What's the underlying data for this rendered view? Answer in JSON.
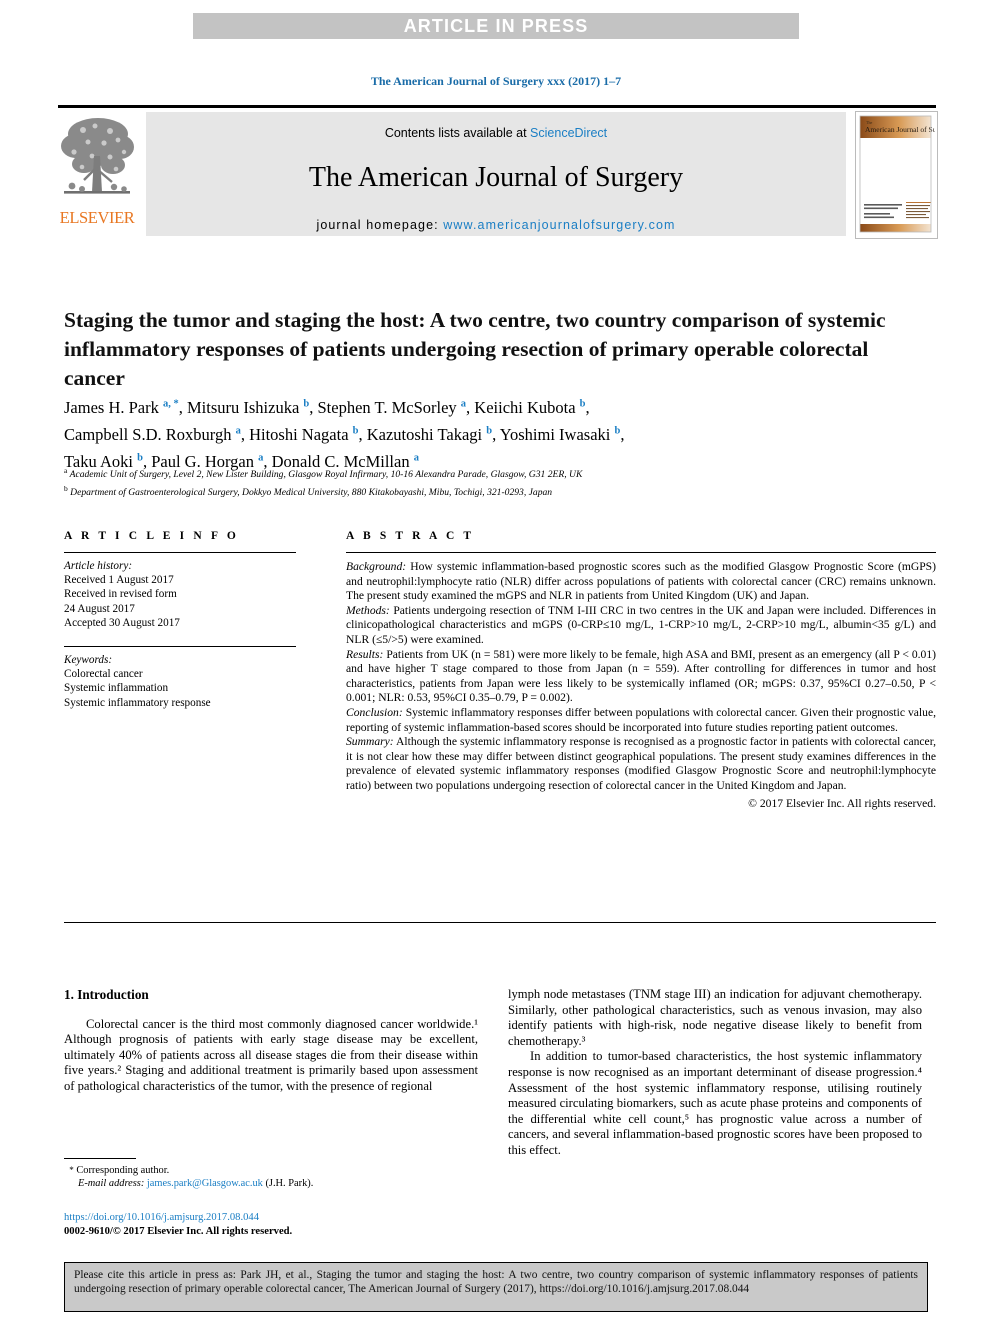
{
  "banner": {
    "text": "ARTICLE IN PRESS"
  },
  "running_head": {
    "text": "The American Journal of Surgery xxx (2017) 1–7"
  },
  "masthead": {
    "contents_prefix": "Contents lists available at ",
    "sciencedirect": "ScienceDirect",
    "journal_name": "The American Journal of Surgery",
    "homepage_prefix": "journal homepage: ",
    "homepage_url": "www.americanjournalofsurgery.com",
    "publisher_logo_text": "ELSEVIER",
    "cover_title": "The American Journal of Surgery",
    "accent_orange": "#e87722",
    "link_blue": "#1a7ec4",
    "band_gray": "#e6e6e6"
  },
  "article": {
    "title": "Staging the tumor and staging the host: A two centre, two country comparison of systemic inflammatory responses of patients undergoing resection of primary operable colorectal cancer",
    "authors": [
      {
        "name": "James H. Park",
        "marks": "a, *"
      },
      {
        "name": "Mitsuru Ishizuka",
        "marks": "b"
      },
      {
        "name": "Stephen T. McSorley",
        "marks": "a"
      },
      {
        "name": "Keiichi Kubota",
        "marks": "b"
      },
      {
        "name": "Campbell S.D. Roxburgh",
        "marks": "a"
      },
      {
        "name": "Hitoshi Nagata",
        "marks": "b"
      },
      {
        "name": "Kazutoshi Takagi",
        "marks": "b"
      },
      {
        "name": "Yoshimi Iwasaki",
        "marks": "b"
      },
      {
        "name": "Taku Aoki",
        "marks": "b"
      },
      {
        "name": "Paul G. Horgan",
        "marks": "a"
      },
      {
        "name": "Donald C. McMillan",
        "marks": "a"
      }
    ],
    "affiliations": [
      {
        "mark": "a",
        "text": "Academic Unit of Surgery, Level 2, New Lister Building, Glasgow Royal Infirmary, 10-16 Alexandra Parade, Glasgow, G31 2ER, UK"
      },
      {
        "mark": "b",
        "text": "Department of Gastroenterological Surgery, Dokkyo Medical University, 880 Kitakobayashi, Mibu, Tochigi, 321-0293, Japan"
      }
    ]
  },
  "article_info": {
    "heading": "A R T I C L E  I N F O",
    "history_label": "Article history:",
    "history": [
      "Received 1 August 2017",
      "Received in revised form",
      "24 August 2017",
      "Accepted 30 August 2017"
    ],
    "keywords_label": "Keywords:",
    "keywords": [
      "Colorectal cancer",
      "Systemic inflammation",
      "Systemic inflammatory response"
    ]
  },
  "abstract": {
    "heading": "A B S T R A C T",
    "sections": [
      {
        "label": "Background:",
        "text": " How systemic inflammation-based prognostic scores such as the modified Glasgow Prognostic Score (mGPS) and neutrophil:lymphocyte ratio (NLR) differ across populations of patients with colorectal cancer (CRC) remains unknown. The present study examined the mGPS and NLR in patients from United Kingdom (UK) and Japan."
      },
      {
        "label": "Methods:",
        "text": " Patients undergoing resection of TNM I-III CRC in two centres in the UK and Japan were included. Differences in clinicopathological characteristics and mGPS (0-CRP≤10 mg/L, 1-CRP>10 mg/L, 2-CRP>10 mg/L, albumin<35 g/L) and NLR (≤5/>5) were examined."
      },
      {
        "label": "Results:",
        "text": " Patients from UK (n = 581) were more likely to be female, high ASA and BMI, present as an emergency (all P < 0.01) and have higher T stage compared to those from Japan (n = 559). After controlling for differences in tumor and host characteristics, patients from Japan were less likely to be systemically inflamed (OR; mGPS: 0.37, 95%CI 0.27–0.50, P < 0.001; NLR: 0.53, 95%CI 0.35–0.79, P = 0.002)."
      },
      {
        "label": "Conclusion:",
        "text": " Systemic inflammatory responses differ between populations with colorectal cancer. Given their prognostic value, reporting of systemic inflammation-based scores should be incorporated into future studies reporting patient outcomes."
      },
      {
        "label": "Summary:",
        "text": " Although the systemic inflammatory response is recognised as a prognostic factor in patients with colorectal cancer, it is not clear how these may differ between distinct geographical populations. The present study examines differences in the prevalence of elevated systemic inflammatory responses (modified Glasgow Prognostic Score and neutrophil:lymphocyte ratio) between two populations undergoing resection of colorectal cancer in the United Kingdom and Japan."
      }
    ],
    "copyright": "© 2017 Elsevier Inc. All rights reserved."
  },
  "introduction": {
    "heading": "1. Introduction",
    "left_paragraphs": [
      "Colorectal cancer is the third most commonly diagnosed cancer worldwide.¹ Although prognosis of patients with early stage disease may be excellent, ultimately 40% of patients across all disease stages die from their disease within five years.² Staging and additional treatment is primarily based upon assessment of pathological characteristics of the tumor, with the presence of regional"
    ],
    "right_paragraphs": [
      "lymph node metastases (TNM stage III) an indication for adjuvant chemotherapy. Similarly, other pathological characteristics, such as venous invasion, may also identify patients with high-risk, node negative disease likely to benefit from chemotherapy.³",
      "In addition to tumor-based characteristics, the host systemic inflammatory response is now recognised as an important determinant of disease progression.⁴ Assessment of the host systemic inflammatory response, utilising routinely measured circulating biomarkers, such as acute phase proteins and components of the differential white cell count,⁵ has prognostic value across a number of cancers, and several inflammation-based prognostic scores have been proposed to this effect."
    ],
    "refs": {
      "r1": "1",
      "r2": "2",
      "r3": "3",
      "r4": "4",
      "r5": "5"
    }
  },
  "footnote": {
    "star": "*",
    "corresponding": "Corresponding author.",
    "email_label": "E-mail address:",
    "email": "james.park@Glasgow.ac.uk",
    "email_owner": "(J.H. Park)."
  },
  "doi_block": {
    "doi_url": "https://doi.org/10.1016/j.amjsurg.2017.08.044",
    "issn_line": "0002-9610/© 2017 Elsevier Inc. All rights reserved."
  },
  "citation_box": {
    "text": "Please cite this article in press as: Park JH, et al., Staging the tumor and staging the host: A two centre, two country comparison of systemic inflammatory responses of patients undergoing resection of primary operable colorectal cancer, The American Journal of Surgery (2017), https://doi.org/10.1016/j.amjsurg.2017.08.044"
  }
}
